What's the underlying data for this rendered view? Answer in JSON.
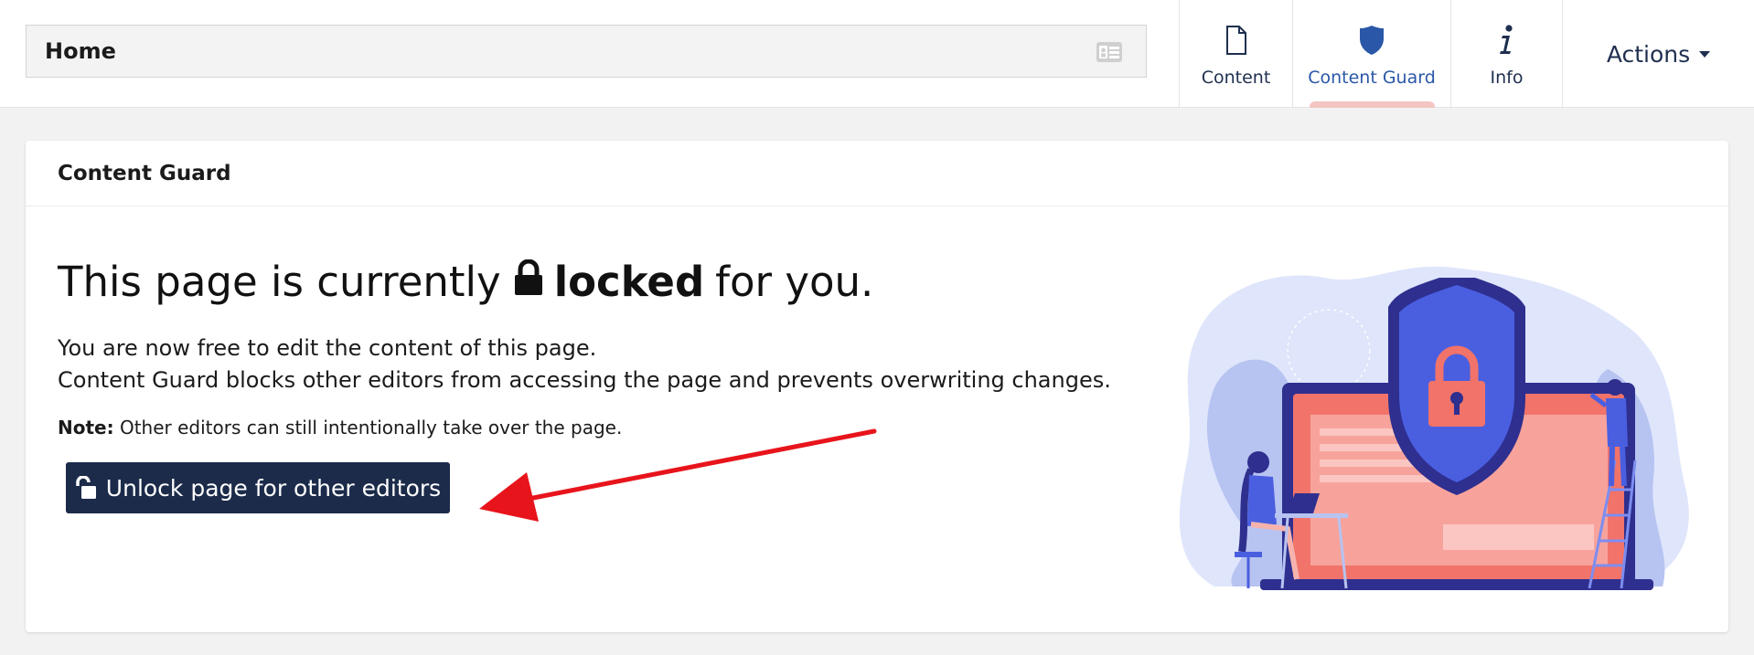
{
  "header": {
    "node_name": "Home",
    "tabs": [
      {
        "label": "Content",
        "icon": "file-icon"
      },
      {
        "label": "Content Guard",
        "icon": "shield-icon",
        "active": true
      },
      {
        "label": "Info",
        "icon": "info-icon"
      }
    ],
    "actions_label": "Actions"
  },
  "panel": {
    "title": "Content Guard",
    "headline_pre": "This page is currently",
    "headline_bold": "locked",
    "headline_post": "for you.",
    "desc_line1": "You are now free to edit the content of this page.",
    "desc_line2": "Content Guard blocks other editors from accessing the page and prevents overwriting changes.",
    "note_label": "Note:",
    "note_text": "Other editors can still intentionally take over the page.",
    "unlock_button": "Unlock page for other editors"
  },
  "colors": {
    "accent": "#2a57a8",
    "button_bg": "#1c2b4a",
    "active_tab_underline": "#f3c6c1",
    "arrow": "#e8141c"
  }
}
